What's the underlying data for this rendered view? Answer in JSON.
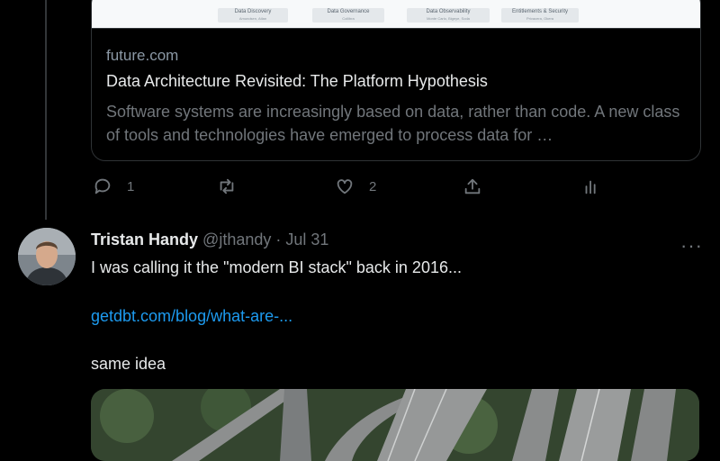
{
  "link_card": {
    "image_categories": [
      {
        "title": "Data Discovery",
        "subtitle": "Amundsen, Atlan"
      },
      {
        "title": "Data Governance",
        "subtitle": "Collibra"
      },
      {
        "title": "Data Observability",
        "subtitle": "Monte Carlo, Bigeye, Soda"
      },
      {
        "title": "Entitlements & Security",
        "subtitle": "Privacera, Okera"
      }
    ],
    "domain": "future.com",
    "title": "Data Architecture Revisited: The Platform Hypothesis",
    "description": "Software systems are increasingly based on data, rather than code. A new class of tools and technologies have emerged to process data for …"
  },
  "first_tweet_actions": {
    "reply_count": "1",
    "retweet_count": "",
    "like_count": "2"
  },
  "tweet": {
    "name": "Tristan Handy",
    "handle": "@jthandy",
    "separator": "·",
    "date": "Jul 31",
    "more_label": "···",
    "text_line1": "I was calling it the \"modern BI stack\" back in 2016...",
    "link_text": "getdbt.com/blog/what-are-...",
    "text_line2": "same idea"
  },
  "colors": {
    "background": "#000000",
    "text_primary": "#e7e9ea",
    "text_secondary": "#71767b",
    "link": "#1d9bf0",
    "border": "#2f3336"
  }
}
